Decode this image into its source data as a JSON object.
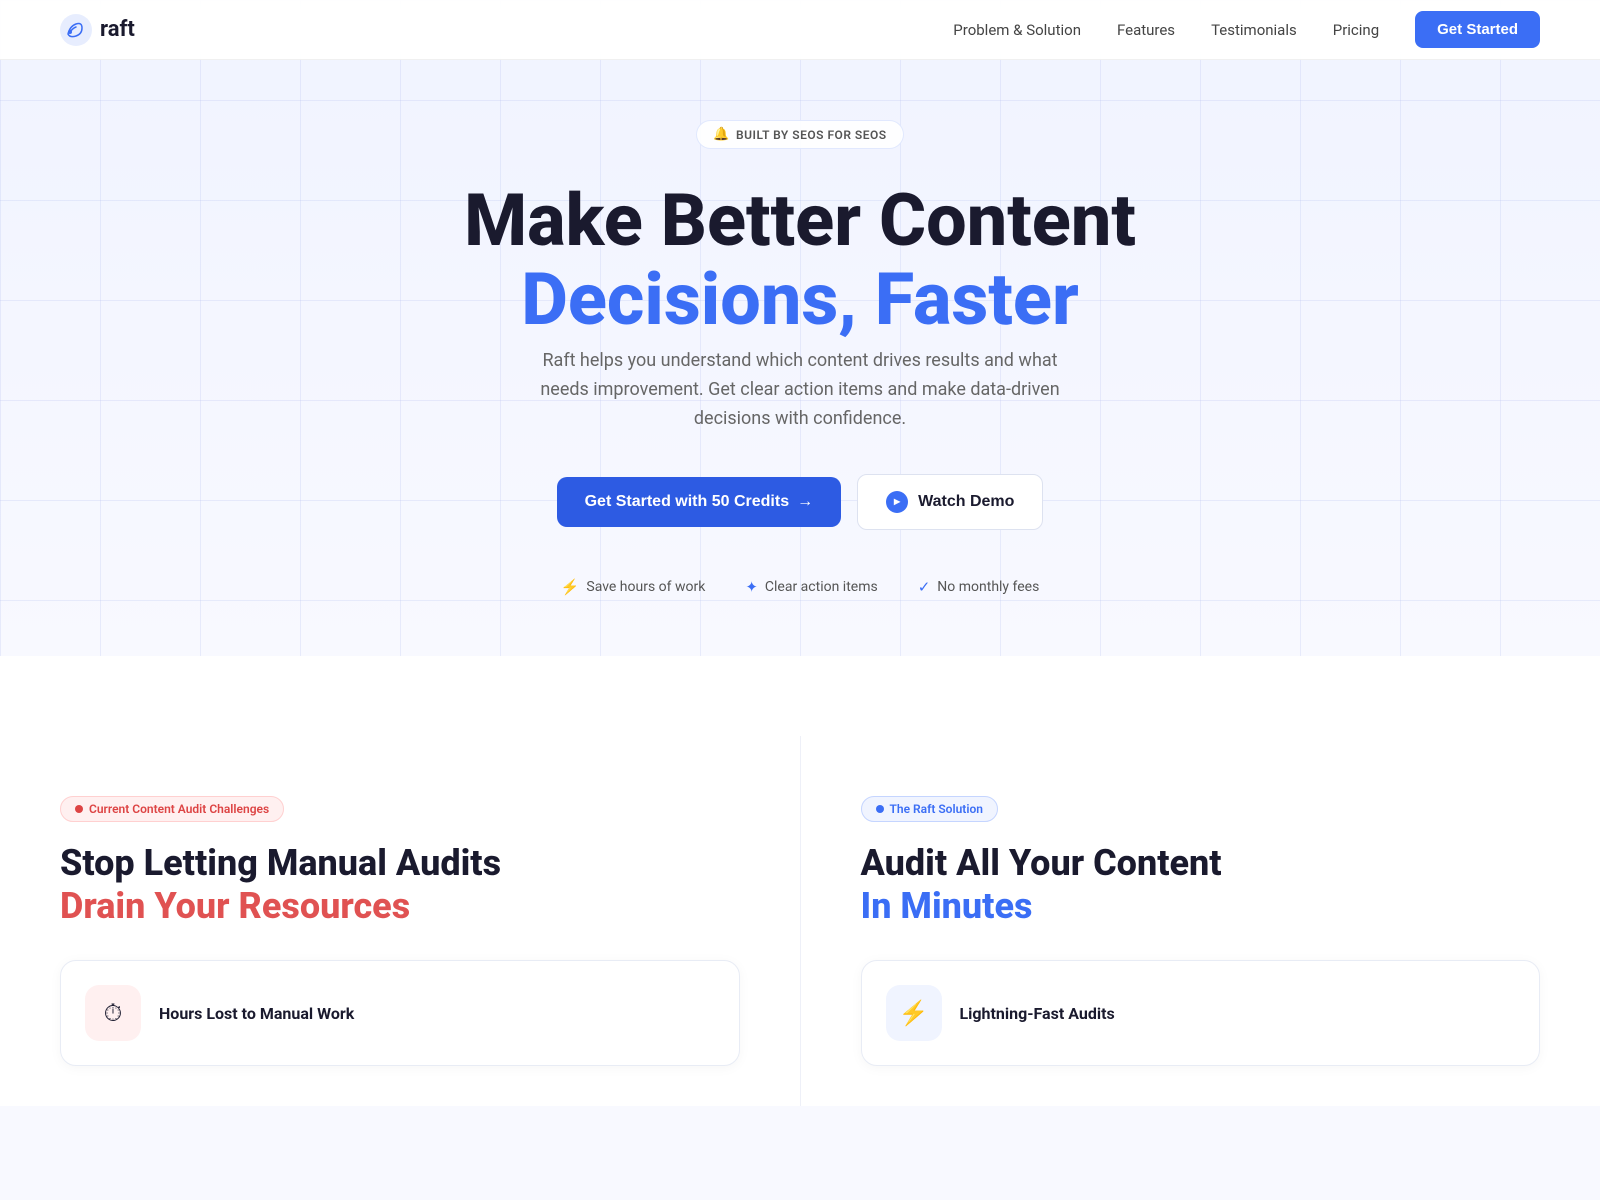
{
  "nav": {
    "logo_text": "raft",
    "links": [
      {
        "label": "Problem & Solution",
        "id": "problem-solution"
      },
      {
        "label": "Features",
        "id": "features"
      },
      {
        "label": "Testimonials",
        "id": "testimonials"
      },
      {
        "label": "Pricing",
        "id": "pricing"
      }
    ],
    "cta_label": "Get Started"
  },
  "hero": {
    "badge_text": "BUILT BY SEOS FOR SEOS",
    "title_line1": "Make Better Content",
    "title_line2": "Decisions, Faster",
    "subtitle": "Raft helps you understand which content drives results and what needs improvement. Get clear action items and make data-driven decisions with confidence.",
    "btn_primary": "Get Started with 50 Credits",
    "btn_secondary": "Watch Demo",
    "features": [
      {
        "icon": "⚡",
        "label": "Save hours of work"
      },
      {
        "icon": "✦",
        "label": "Clear action items"
      },
      {
        "icon": "✓",
        "label": "No monthly fees"
      }
    ]
  },
  "problem_section": {
    "badge": "Current Content Audit Challenges",
    "title_line1": "Stop Letting Manual Audits",
    "title_line2": "Drain Your Resources",
    "card": {
      "icon": "⏱",
      "title": "Hours Lost to Manual Work"
    }
  },
  "solution_section": {
    "badge": "The Raft Solution",
    "title_line1": "Audit All Your Content",
    "title_line2": "In Minutes",
    "card": {
      "icon": "⚡",
      "title": "Lightning-Fast Audits"
    }
  }
}
